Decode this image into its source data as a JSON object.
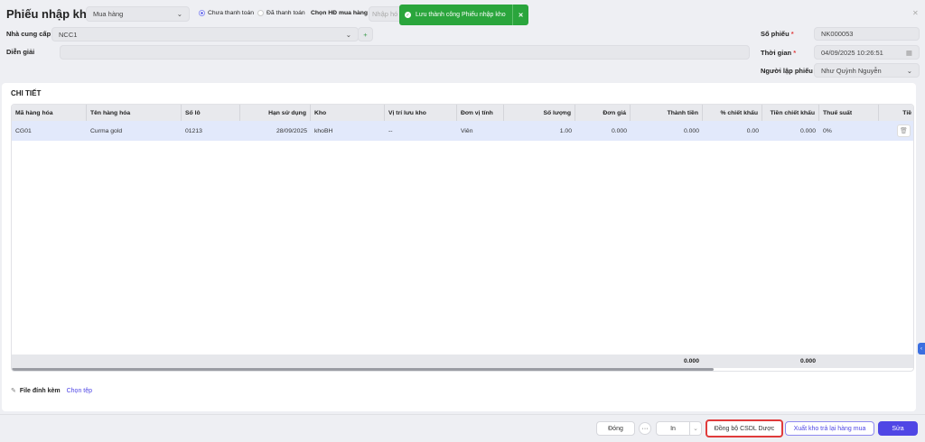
{
  "header": {
    "title": "Phiếu nhập kho",
    "type_select": "Mua hàng",
    "radio_unpaid": "Chưa thanh toán",
    "radio_paid": "Đã thanh toán",
    "purchase_invoice_label": "Chọn HĐ mua hàng",
    "purchase_invoice_placeholder": "Nhập hó"
  },
  "toast": {
    "message": "Lưu thành công Phiếu nhập kho",
    "color": "#2aa53c"
  },
  "form": {
    "supplier_label": "Nhà cung cấp",
    "supplier_value": "NCC1",
    "desc_label": "Diễn giải",
    "desc_value": "",
    "voucher_no_label": "Số phiếu",
    "voucher_no_value": "NK000053",
    "time_label": "Thời gian",
    "time_value": "04/09/2025 10:26:51",
    "creator_label": "Người lập phiếu",
    "creator_value": "Như Quỳnh Nguyễn"
  },
  "detail": {
    "title": "CHI TIẾT",
    "columns": [
      "Mã hàng hóa",
      "Tên hàng hóa",
      "Số lô",
      "Hạn sử dụng",
      "Kho",
      "Vị trí lưu kho",
      "Đơn vị tính",
      "Số lượng",
      "Đơn giá",
      "Thành tiền",
      "% chiết khấu",
      "Tiền chiết khấu",
      "Thuế suất",
      "Tiề"
    ],
    "rows": [
      {
        "code": "CG01",
        "name": "Curma gold",
        "lot": "01213",
        "expiry": "28/09/2025",
        "warehouse": "khoBH",
        "location": "--",
        "unit": "Viên",
        "qty": "1.00",
        "price": "0.000",
        "amount": "0.000",
        "discount_pct": "0.00",
        "discount_amt": "0.000",
        "tax": "0%"
      }
    ],
    "totals": {
      "amount": "0.000",
      "discount_amt": "0.000"
    }
  },
  "attachment": {
    "label": "File đính kèm",
    "choose": "Chọn tệp"
  },
  "footer": {
    "close": "Đóng",
    "more": "···",
    "print": "In",
    "sync": "Đồng bộ CSDL Dược",
    "return": "Xuất kho trả lại hàng mua",
    "edit": "Sửa",
    "accent": "#4f46e5"
  }
}
